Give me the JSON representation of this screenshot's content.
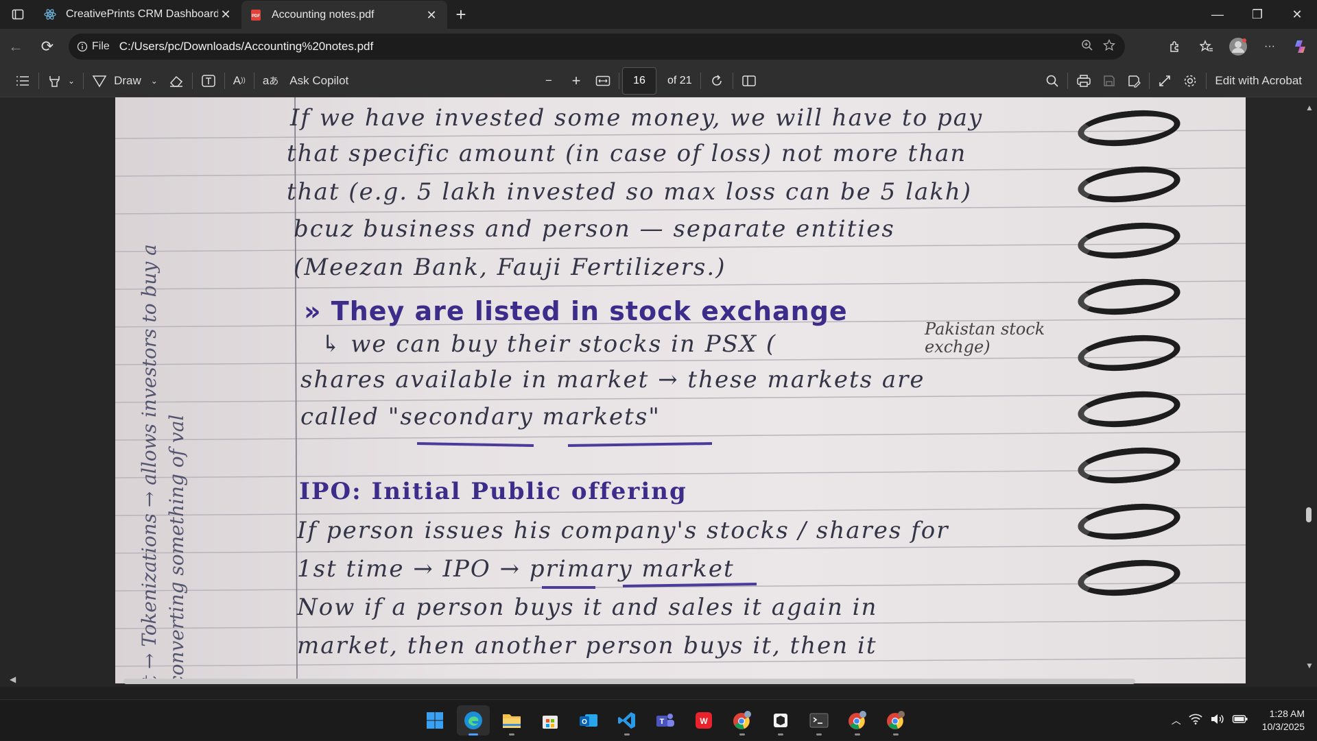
{
  "tabs": [
    {
      "title": "CreativePrints CRM Dashboard",
      "active": false
    },
    {
      "title": "Accounting notes.pdf",
      "active": true
    }
  ],
  "addressbar": {
    "info_label": "File",
    "url": "C:/Users/pc/Downloads/Accounting%20notes.pdf"
  },
  "pdf_toolbar": {
    "draw_label": "Draw",
    "ask_copilot_label": "Ask Copilot",
    "page_number": "16",
    "page_total": "of 21",
    "edit_label": "Edit with Acrobat"
  },
  "document": {
    "margin_line1": "ct → Tokenizations → allows investors to buy a",
    "margin_line2": "(converting something of val",
    "lines": [
      "If we have invested some money, we will have to pay",
      "that specific amount (in case of loss) not more than",
      "that (e.g. 5 lakh invested so max loss can be 5 lakh)",
      "bcuz business and person — separate entities",
      "(Meezan Bank, Fauji Fertilizers.)",
      "They are listed in stock exchange",
      "we can buy their stocks in PSX (",
      "shares available in market → these markets are",
      "called \"secondary markets\"",
      "IPO: Initial Public offering",
      "If person issues his company's stocks / shares for",
      "1st time → IPO → primary market",
      "Now if a person buys it and sales it again in",
      "market, then another person buys it, then it"
    ],
    "psx_note": "Pakistan stock exchge)"
  },
  "taskbar": {
    "time": "1:28 AM",
    "date": "10/3/2025"
  }
}
